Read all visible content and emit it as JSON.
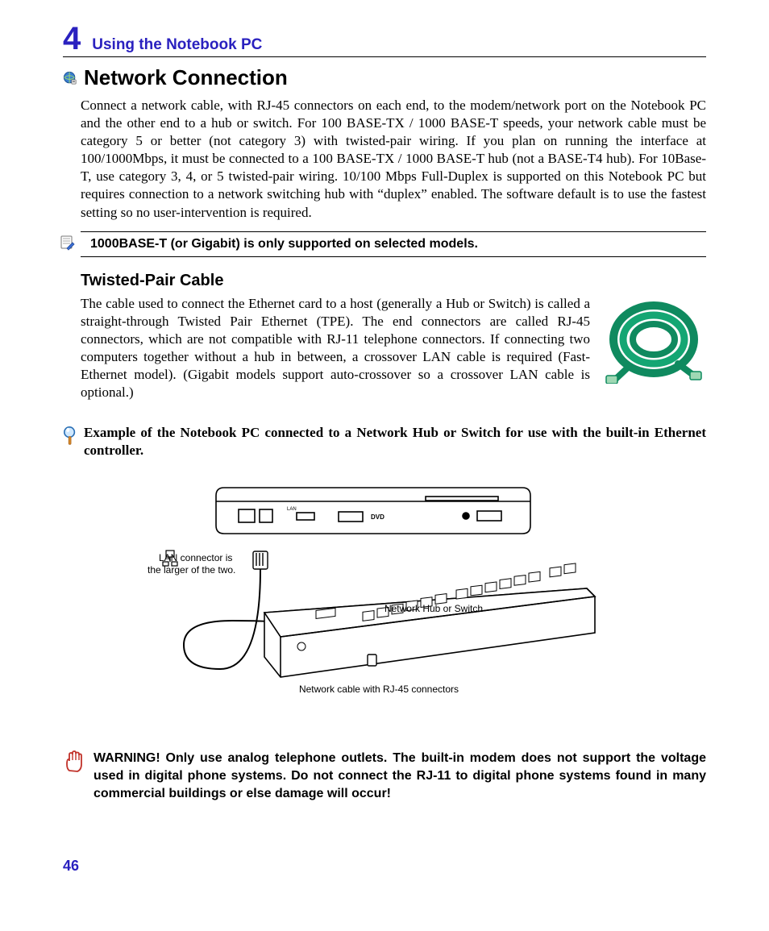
{
  "chapter": {
    "number": "4",
    "title": "Using the Notebook PC"
  },
  "section": {
    "icon_name": "globe-connect-icon",
    "title": "Network Connection",
    "body": "Connect a network cable, with RJ-45 connectors on each end, to the modem/network port on the Notebook PC and the other end to a hub or switch. For 100 BASE-TX / 1000 BASE-T speeds, your network cable must be category 5 or better (not category 3) with twisted-pair wiring. If you plan on running the interface at 100/1000Mbps, it must be connected to a 100 BASE-TX / 1000 BASE-T hub (not a BASE-T4 hub). For 10Base-T, use category 3, 4, or 5 twisted-pair wiring. 10/100 Mbps Full-Duplex is supported on this Notebook PC but requires connection to a network switching hub with “duplex” enabled. The software default is to use the fastest setting so no user-intervention is required."
  },
  "note": {
    "icon_name": "note-pencil-icon",
    "text": "1000BASE-T (or Gigabit) is only supported on selected models."
  },
  "subsection": {
    "title": "Twisted-Pair Cable",
    "body": "The cable used to connect the Ethernet card to a host (generally a Hub or Switch) is called a straight-through Twisted Pair Ethernet (TPE). The end connectors are called RJ-45 connectors, which are not compatible with RJ-11 telephone connectors. If connecting two computers together without a hub in between, a crossover LAN cable is required (Fast-Ethernet model). (Gigabit models support auto-crossover so a crossover LAN cable is optional.)",
    "image_name": "ethernet-cable-coil"
  },
  "example": {
    "icon_name": "magnifier-icon",
    "text": "Example of the Notebook PC connected to a Network Hub or Switch for use with the built-in Ethernet controller."
  },
  "diagram": {
    "lan_label": "LAN connector is the larger of the two.",
    "hub_label": "Network Hub or Switch",
    "cable_label": "Network cable with RJ-45 connectors"
  },
  "warning": {
    "icon_name": "warning-hand-icon",
    "text": "WARNING!  Only use analog telephone outlets. The built-in modem does not support the voltage used in digital phone systems. Do not connect the RJ-11 to digital phone systems found in many commercial buildings or else damage will occur!"
  },
  "page_number": "46"
}
